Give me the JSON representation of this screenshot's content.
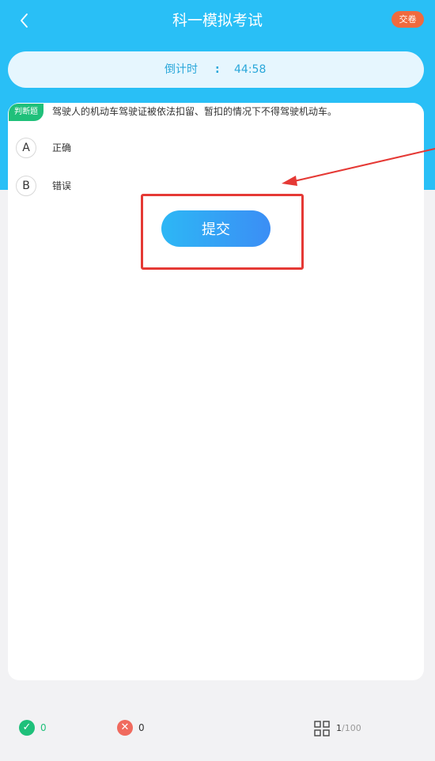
{
  "header": {
    "title": "科一模拟考试",
    "submit_badge": "交卷"
  },
  "timer": {
    "label": "倒计时",
    "separator": ":",
    "value": "44:58"
  },
  "question": {
    "type_tag": "判断题",
    "text": "驾驶人的机动车驾驶证被依法扣留、暂扣的情况下不得驾驶机动车。",
    "options": [
      {
        "letter": "A",
        "text": "正确"
      },
      {
        "letter": "B",
        "text": "错误"
      }
    ]
  },
  "submit_button": {
    "label": "提交"
  },
  "footer": {
    "correct_count": "0",
    "wrong_count": "0",
    "progress_current": "1",
    "progress_total": "/100"
  },
  "colors": {
    "header_bg": "#29bff6",
    "accent_orange": "#f06a3e",
    "correct_green": "#1fc07a",
    "wrong_red": "#f06a5e",
    "highlight_red": "#e53935"
  },
  "icons": {
    "back": "chevron-left-icon",
    "correct": "check-circle-icon",
    "wrong": "x-circle-icon",
    "grid": "grid-icon"
  }
}
